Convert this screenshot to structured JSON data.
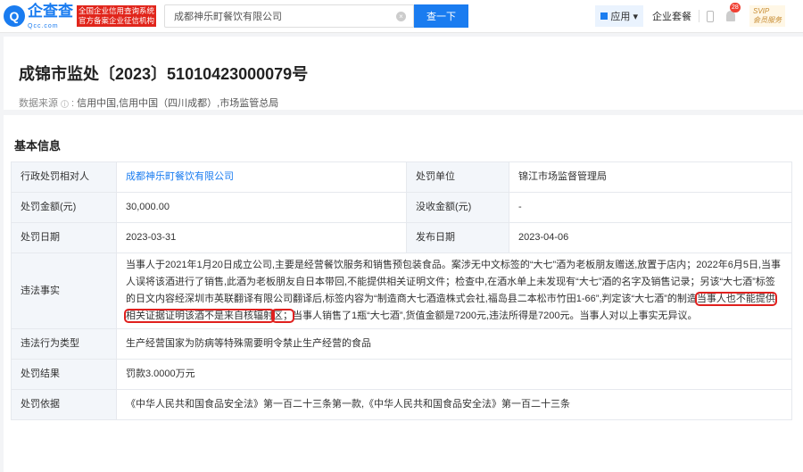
{
  "header": {
    "logo_text": "企查查",
    "logo_sub": "Qcc.com",
    "badge_line1": "全国企业信用查询系统",
    "badge_line2": "官方备案企业征信机构",
    "search_value": "成都神乐町餐饮有限公司",
    "search_button": "查一下",
    "apps": "应用",
    "package": "企业套餐",
    "notif_count": "28",
    "svip": "SVIP",
    "svip_sub": "会员服务"
  },
  "page": {
    "title": "成锦市监处〔2023〕51010423000079号",
    "source_label": "数据来源",
    "source_value": "信用中国,信用中国（四川成都）,市场监管总局"
  },
  "section": {
    "title": "基本信息",
    "rows": [
      {
        "l1": "行政处罚相对人",
        "v1": "成都神乐町餐饮有限公司",
        "l2": "处罚单位",
        "v2": "锦江市场监督管理局"
      },
      {
        "l1": "处罚金额(元)",
        "v1": "30,000.00",
        "l2": "没收金额(元)",
        "v2": "-"
      },
      {
        "l1": "处罚日期",
        "v1": "2023-03-31",
        "l2": "发布日期",
        "v2": "2023-04-06"
      }
    ],
    "facts_label": "违法事实",
    "facts_a": "当事人于2021年1月20日成立公司,主要是经营餐饮服务和销售预包装食品。案涉无中文标签的“大七”酒为老板朋友赠送,放置于店内；2022年6月5日,当事人误将该酒进行了销售,此酒为老板朋友自日本带回,不能提供相关证明文件；检查中,在酒水单上未发现有“大七”酒的名字及销售记录；另该“大七酒”标签的日文内容经深圳市英联翻译有限公司翻译后,标签内容为“制造商大七酒造株式会社,福岛县二本松市竹田1-66”,判定该“大七酒”的制造",
    "facts_hl1": "当事人也不能提供相关证据证明该酒不是来自核辐射",
    "facts_hl2": "区；",
    "facts_b": "当事人销售了1瓶“大七酒”,货值金额是7200元,违法所得是7200元。当事人对以上事实无异议。",
    "type_label": "违法行为类型",
    "type_value": "生产经营国家为防病等特殊需要明令禁止生产经营的食品",
    "result_label": "处罚结果",
    "result_value": "罚款3.0000万元",
    "basis_label": "处罚依据",
    "basis_value": "《中华人民共和国食品安全法》第一百二十三条第一款,《中华人民共和国食品安全法》第一百二十三条"
  }
}
